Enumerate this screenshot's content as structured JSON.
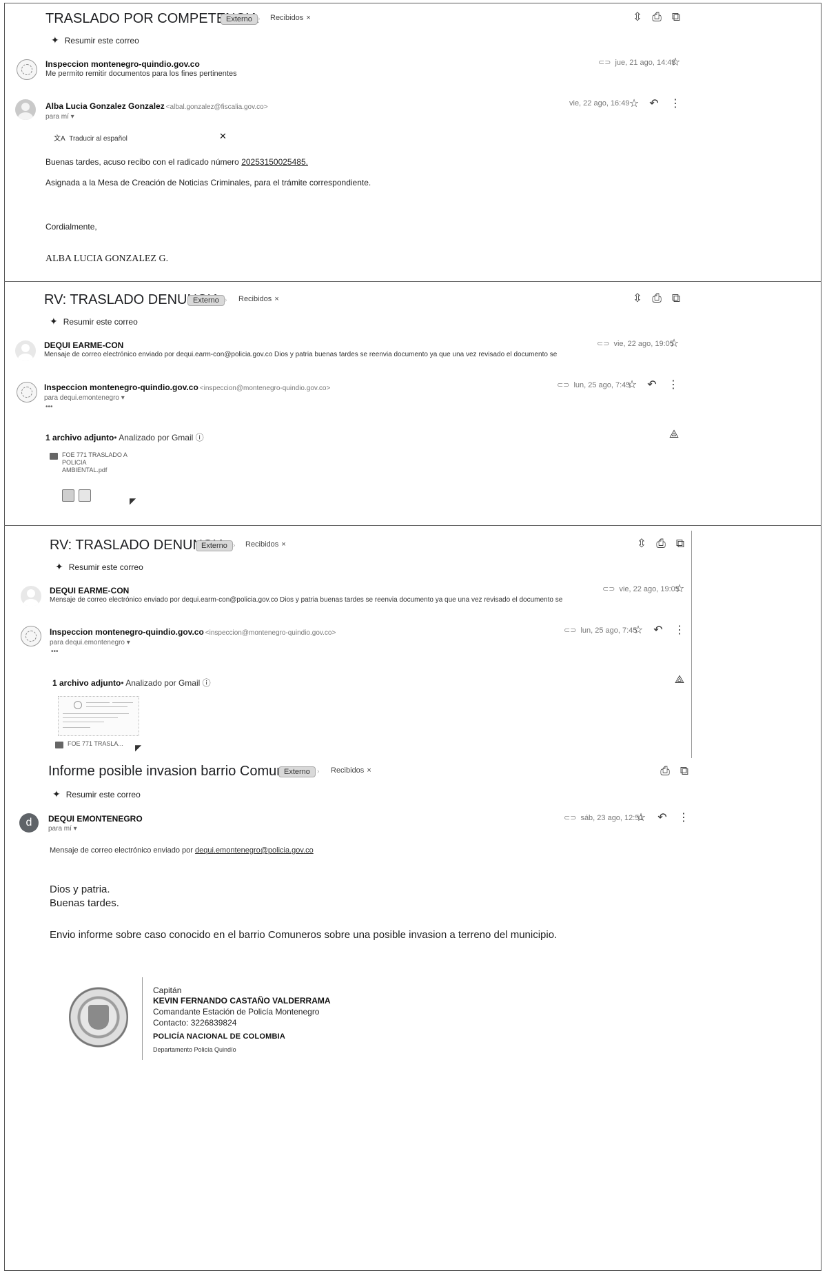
{
  "summarize_label": "Resumir este correo",
  "tag_external": "Externo",
  "tag_inbox": "Recibidos",
  "t1": {
    "subject": "TRASLADO POR COMPETENCIA",
    "msg1": {
      "sender": "Inspeccion montenegro-quindio.gov.co",
      "snippet": "Me permito remitir documentos para los fines pertinentes",
      "date": "jue, 21 ago, 14:48"
    },
    "msg2": {
      "sender": "Alba Lucia Gonzalez Gonzalez",
      "email": "<albal.gonzalez@fiscalia.gov.co>",
      "to": "para mí",
      "date": "vie, 22 ago, 16:49",
      "translate_label": "Traducir al español",
      "line1_prefix": "Buenas tardes, acuso recibo con el radicado número",
      "radicado": "20253150025485.",
      "line2": "Asignada a la Mesa de Creación de Noticias Criminales, para el trámite correspondiente.",
      "closing": "Cordialmente,",
      "signature": "ALBA LUCIA GONZALEZ G."
    }
  },
  "t2": {
    "subject": "RV: TRASLADO DENUNCIA",
    "msg1": {
      "sender": "DEQUI EARME-CON",
      "snippet": "Mensaje de correo electrónico enviado por dequi.earm-con@policia.gov.co Dios y patria buenas tardes se reenvia documento ya que una vez revisado el documento se",
      "date": "vie, 22 ago, 19:05"
    },
    "msg2": {
      "sender": "Inspeccion montenegro-quindio.gov.co",
      "email": "<inspeccion@montenegro-quindio.gov.co>",
      "to": "para dequi.emontenegro",
      "date": "lun, 25 ago, 7:45",
      "ellipsis": "•••",
      "attach_count": "1 archivo adjunto",
      "attach_scanned": "• Analizado por Gmail",
      "file_name_1": "FOE 771 TRASLADO A",
      "file_name_2": "POLICIA",
      "file_name_3": "AMBIENTAL.pdf"
    }
  },
  "t3": {
    "subject": "RV: TRASLADO DENUNCIA",
    "msg1": {
      "sender": "DEQUI EARME-CON",
      "snippet": "Mensaje de correo electrónico enviado por dequi.earm-con@policia.gov.co Dios y patria buenas tardes se reenvia documento ya que una vez revisado el documento se",
      "date": "vie, 22 ago, 19:05"
    },
    "msg2": {
      "sender": "Inspeccion montenegro-quindio.gov.co",
      "email": "<inspeccion@montenegro-quindio.gov.co>",
      "to": "para dequi.emontenegro",
      "date": "lun, 25 ago, 7:45",
      "ellipsis": "•••",
      "attach_count": "1 archivo adjunto",
      "attach_scanned": "• Analizado por Gmail",
      "file_name": "FOE 771 TRASLA..."
    }
  },
  "t4": {
    "subject": "Informe posible invasion barrio Comuneros",
    "msg": {
      "avatar_letter": "d",
      "sender": "DEQUI EMONTENEGRO",
      "to": "para mí",
      "date": "sáb, 23 ago, 12:51",
      "intro_prefix": "Mensaje de correo electrónico enviado por",
      "intro_email": "dequi.emontenegro@policia.gov.co",
      "greet1": "Dios y patria.",
      "greet2": "Buenas tardes.",
      "body": "Envio informe sobre caso conocido en el barrio Comuneros sobre una posible invasion a terreno del municipio.",
      "sig_rank": "Capitán",
      "sig_name": "KEVIN FERNANDO CASTAÑO VALDERRAMA",
      "sig_role": "Comandante Estación de Policía Montenegro",
      "sig_contact": "Contacto: 3226839824",
      "sig_org": "POLICÍA NACIONAL DE COLOMBIA",
      "sig_dept": "Departamento Policía Quindío"
    }
  },
  "icons": {
    "expand": "⇳",
    "print": "⎙",
    "open_new": "⧉",
    "star": "☆",
    "reply": "↶",
    "more": "⋮",
    "clip": "⊂⊃",
    "close": "✕",
    "drive_add": "⟁"
  }
}
